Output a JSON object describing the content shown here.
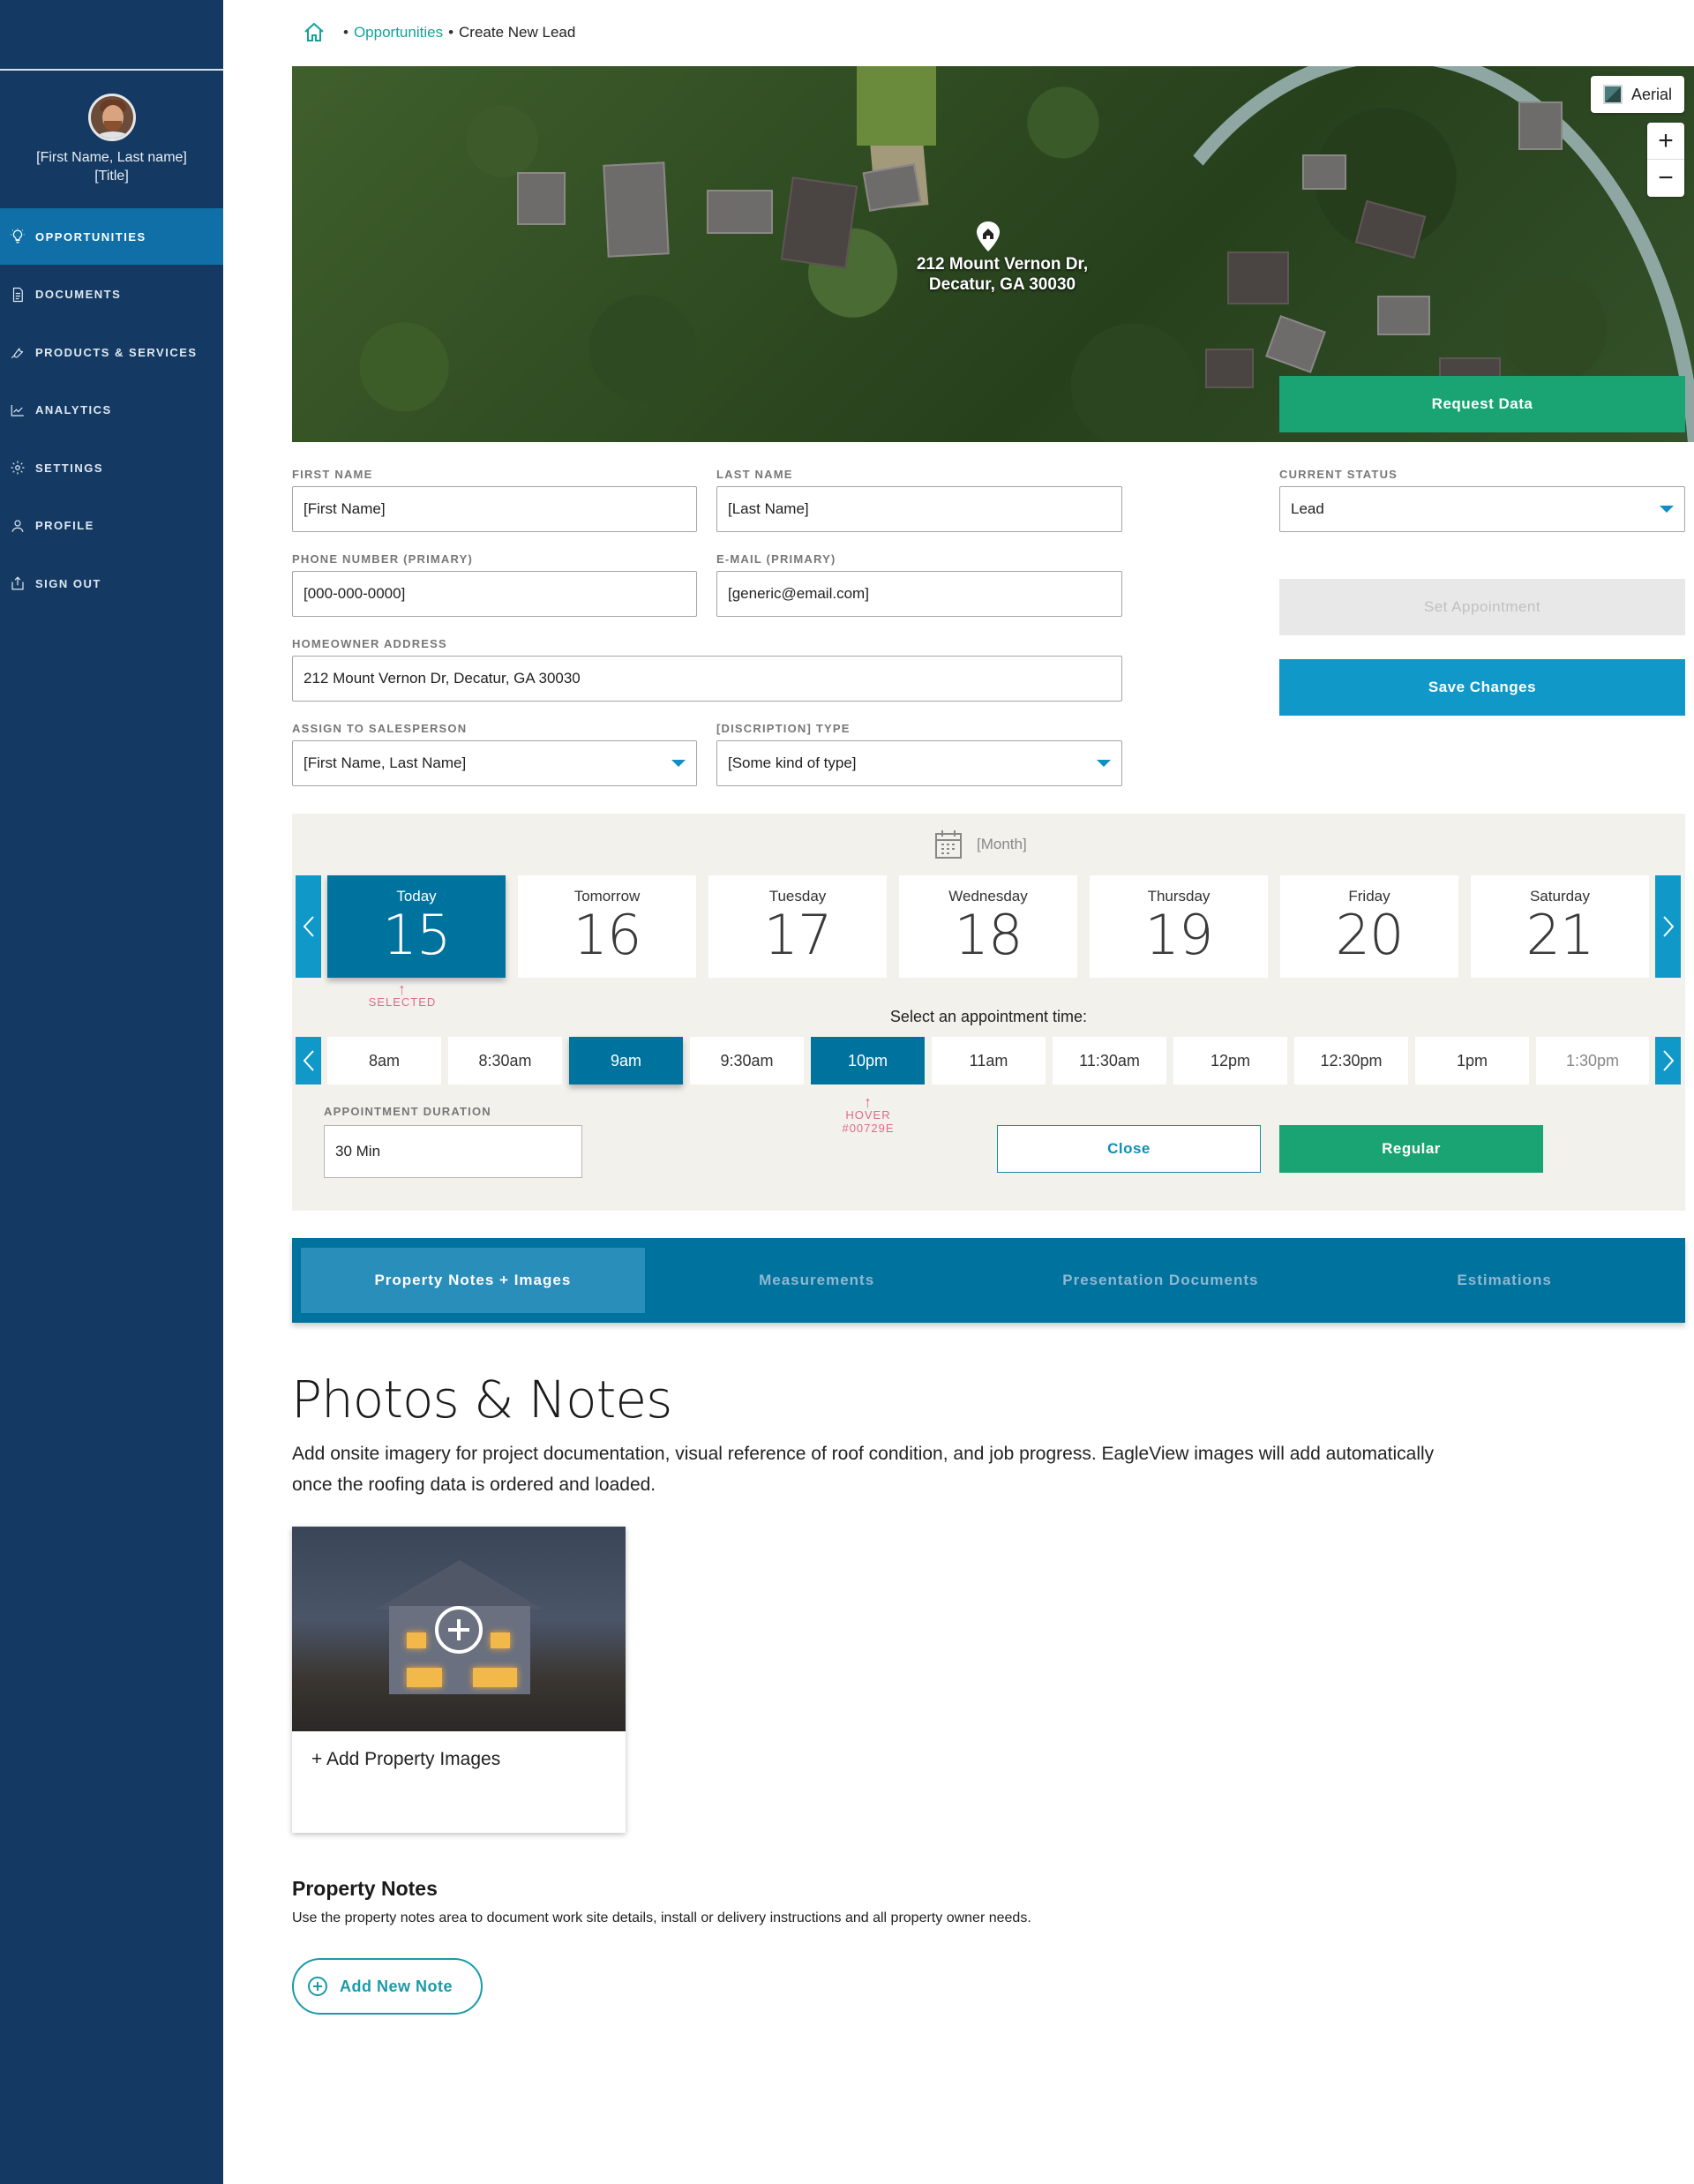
{
  "user": {
    "name": "[First Name, Last name]",
    "title": "[Title]"
  },
  "nav": [
    {
      "label": "OPPORTUNITIES",
      "icon": "lightbulb-icon",
      "active": true
    },
    {
      "label": "DOCUMENTS",
      "icon": "document-icon",
      "active": false
    },
    {
      "label": "PRODUCTS & SERVICES",
      "icon": "wrench-icon",
      "active": false
    },
    {
      "label": "ANALYTICS",
      "icon": "chart-icon",
      "active": false
    },
    {
      "label": "SETTINGS",
      "icon": "gear-icon",
      "active": false
    },
    {
      "label": "PROFILE",
      "icon": "person-icon",
      "active": false
    },
    {
      "label": "SIGN OUT",
      "icon": "sign-out-icon",
      "active": false
    }
  ],
  "breadcrumb": {
    "home_icon": "home-icon",
    "separator": "•",
    "parent": "Opportunities",
    "current": "Create New Lead"
  },
  "map": {
    "address_line1": "212 Mount Vernon Dr,",
    "address_line2": "Decatur, GA 30030",
    "aerial_label": "Aerial",
    "zoom_in": "+",
    "zoom_out": "−",
    "request_label": "Request Data"
  },
  "form": {
    "first_name": {
      "label": "FIRST NAME",
      "value": "[First Name]"
    },
    "last_name": {
      "label": "LAST NAME",
      "value": "[Last Name]"
    },
    "phone": {
      "label": "PHONE NUMBER (PRIMARY)",
      "value": "[000-000-0000]"
    },
    "email": {
      "label": "E-MAIL (PRIMARY)",
      "value": "[generic@email.com]"
    },
    "address": {
      "label": "HOMEOWNER ADDRESS",
      "value": "212 Mount Vernon Dr, Decatur, GA 30030"
    },
    "salesperson": {
      "label": "ASSIGN TO SALESPERSON",
      "value": "[First Name, Last Name]"
    },
    "type": {
      "label": "[DISCRIPTION] TYPE",
      "value": "[Some kind of type]"
    },
    "status": {
      "label": "CURRENT STATUS",
      "value": "Lead"
    },
    "set_appointment": "Set Appointment",
    "save_changes": "Save Changes"
  },
  "calendar": {
    "month": "[Month]",
    "days": [
      {
        "name": "Today",
        "num": "15"
      },
      {
        "name": "Tomorrow",
        "num": "16"
      },
      {
        "name": "Tuesday",
        "num": "17"
      },
      {
        "name": "Wednesday",
        "num": "18"
      },
      {
        "name": "Thursday",
        "num": "19"
      },
      {
        "name": "Friday",
        "num": "20"
      },
      {
        "name": "Saturday",
        "num": "21"
      }
    ],
    "selected_note": "SELECTED",
    "select_time": "Select an appointment time:",
    "slots": [
      "8am",
      "8:30am",
      "9am",
      "9:30am",
      "10pm",
      "11am",
      "11:30am",
      "12pm",
      "12:30pm",
      "1pm",
      "1:30pm"
    ],
    "hover_note": "HOVER",
    "hover_color": "#00729E",
    "duration_label": "APPOINTMENT DURATION",
    "duration_value": "30 Min",
    "close_label": "Close",
    "regular_label": "Regular"
  },
  "tabs": [
    "Property Notes + Images",
    "Measurements",
    "Presentation Documents",
    "Estimations"
  ],
  "photos": {
    "heading": "Photos & Notes",
    "description": "Add onsite imagery for project documentation, visual reference of roof condition, and job progress. EagleView images will add automatically once the roofing data is ordered and loaded.",
    "add_images": "+ Add Property Images"
  },
  "notes": {
    "heading": "Property Notes",
    "description": "Use the property notes area to document work site details, install or delivery instructions and all property owner needs.",
    "add_note": "Add New Note"
  },
  "colors": {
    "sidebar": "#143A63",
    "accent_blue": "#0F98C8",
    "selected_blue": "#00729E",
    "green": "#1AA474",
    "annotation_pink": "#E06A8C"
  }
}
